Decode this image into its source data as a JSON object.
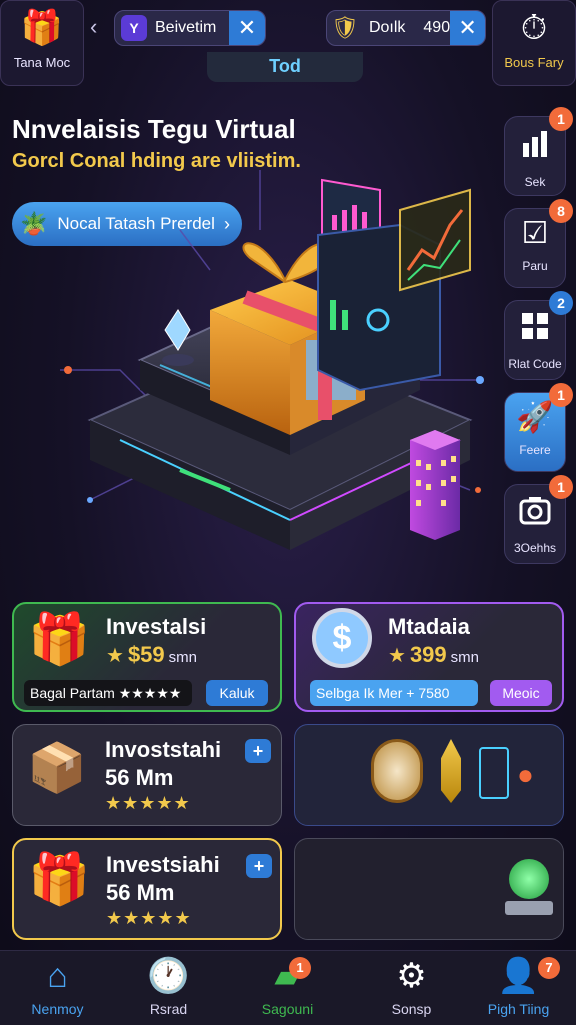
{
  "top_left": {
    "label": "Tana Moc",
    "icon": "gift-box-icon"
  },
  "top_right": {
    "label": "Bous Fary",
    "icon": "clock-badge-icon"
  },
  "search_pill": {
    "text": "Beivetim"
  },
  "currency_pill": {
    "label": "Doılk",
    "value": "490"
  },
  "tab": {
    "label": "Tod"
  },
  "hero": {
    "title": "Nnvelaisis Tegu Virtual",
    "subtitle": "Gorcl Conal  hding are vliistim.",
    "cta_label": "Nocal Tatash Prerdel"
  },
  "side_buttons": [
    {
      "label": "Sek",
      "badge": "1",
      "badge_color": "#f26b3a",
      "icon": "bar-chart-icon"
    },
    {
      "label": "Paru",
      "badge": "8",
      "badge_color": "#f26b3a",
      "icon": "check-edit-icon"
    },
    {
      "label": "Rlat Code",
      "badge": "2",
      "badge_color": "#2e7bd6",
      "icon": "grid-icon"
    },
    {
      "label": "Feere",
      "badge": "1",
      "badge_color": "#f26b3a",
      "icon": "rocket-icon"
    },
    {
      "label": "3Oehhs",
      "badge": "1",
      "badge_color": "#f26b3a",
      "icon": "camera-icon"
    }
  ],
  "cards": {
    "card1": {
      "title": "Investalsi",
      "price": "$59",
      "unit": "smn",
      "strip_text": "Bagal Partam ★★★★★",
      "button": "Kaluk"
    },
    "card2": {
      "title": "Mtadaia",
      "price": "399",
      "unit": "smn",
      "strip_text": "Selbga Ik Mer + 7580",
      "button": "Meoic"
    },
    "card3": {
      "title": "Invoststahi",
      "amount": "56 Mm",
      "stars": "★★★★★",
      "button": "+"
    },
    "card5": {
      "title": "Investsiahi",
      "amount": "56 Mm",
      "stars": "★★★★★",
      "button": "+"
    }
  },
  "nav": [
    {
      "label": "Nenmoy",
      "icon": "home-icon",
      "active": true
    },
    {
      "label": "Rsrad",
      "icon": "clock-icon"
    },
    {
      "label": "Sagouni",
      "icon": "folder-icon",
      "badge": "1"
    },
    {
      "label": "Sonsp",
      "icon": "gear-icon"
    },
    {
      "label": "Pigh Tiing",
      "icon": "user-icon",
      "badge": "7"
    }
  ],
  "colors": {
    "accent_blue": "#2e7bd6",
    "gold": "#f2c94c",
    "badge_orange": "#f26b3a",
    "card_green": "#3fb950",
    "card_purple": "#a25bf0"
  }
}
